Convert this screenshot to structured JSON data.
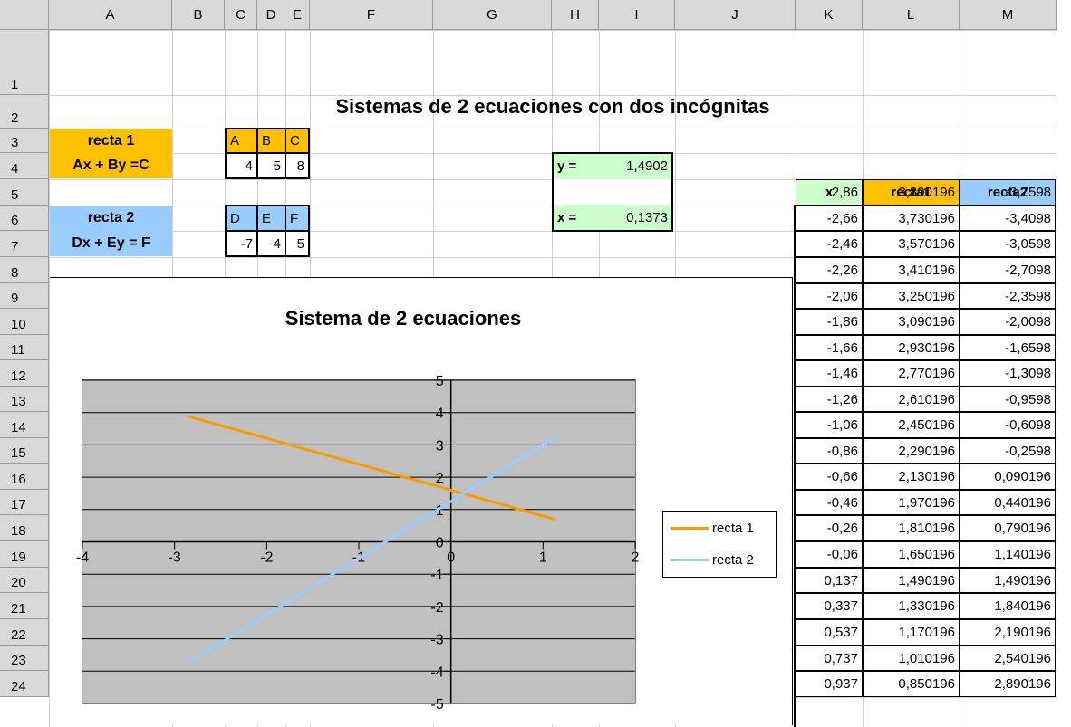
{
  "title": "Sistemas de 2 ecuaciones con dos incógnitas",
  "columns": [
    "A",
    "B",
    "C",
    "D",
    "E",
    "F",
    "G",
    "H",
    "I",
    "J",
    "K",
    "L",
    "M"
  ],
  "rows": [
    "1",
    "2",
    "3",
    "4",
    "5",
    "6",
    "7",
    "8",
    "9",
    "10",
    "11",
    "12",
    "13",
    "14",
    "15",
    "16",
    "17",
    "18",
    "19",
    "20",
    "21",
    "22",
    "23",
    "24"
  ],
  "recta1": {
    "label": "recta 1",
    "formula": "Ax + By =C",
    "headers": [
      "A",
      "B",
      "C"
    ],
    "values": [
      "4",
      "5",
      "8"
    ]
  },
  "recta2": {
    "label": "recta 2",
    "formula": "Dx + Ey = F",
    "headers": [
      "D",
      "E",
      "F"
    ],
    "values": [
      "-7",
      "4",
      "5"
    ]
  },
  "solution": {
    "y_label": "y =",
    "y_value": "1,4902",
    "x_label": "x =",
    "x_value": "0,1373"
  },
  "table": {
    "headers": [
      "x",
      "recta1",
      "recta2"
    ],
    "rows": [
      [
        "-2,86",
        "3,890196",
        "-3,7598"
      ],
      [
        "-2,66",
        "3,730196",
        "-3,4098"
      ],
      [
        "-2,46",
        "3,570196",
        "-3,0598"
      ],
      [
        "-2,26",
        "3,410196",
        "-2,7098"
      ],
      [
        "-2,06",
        "3,250196",
        "-2,3598"
      ],
      [
        "-1,86",
        "3,090196",
        "-2,0098"
      ],
      [
        "-1,66",
        "2,930196",
        "-1,6598"
      ],
      [
        "-1,46",
        "2,770196",
        "-1,3098"
      ],
      [
        "-1,26",
        "2,610196",
        "-0,9598"
      ],
      [
        "-1,06",
        "2,450196",
        "-0,6098"
      ],
      [
        "-0,86",
        "2,290196",
        "-0,2598"
      ],
      [
        "-0,66",
        "2,130196",
        "0,090196"
      ],
      [
        "-0,46",
        "1,970196",
        "0,440196"
      ],
      [
        "-0,26",
        "1,810196",
        "0,790196"
      ],
      [
        "-0,06",
        "1,650196",
        "1,140196"
      ],
      [
        "0,137",
        "1,490196",
        "1,490196"
      ],
      [
        "0,337",
        "1,330196",
        "1,840196"
      ],
      [
        "0,537",
        "1,170196",
        "2,190196"
      ],
      [
        "0,737",
        "1,010196",
        "2,540196"
      ],
      [
        "0,937",
        "0,850196",
        "2,890196"
      ]
    ]
  },
  "colors": {
    "orange": "#ffc000",
    "blue": "#99ccff",
    "green": "#ccffcc",
    "series1": "#ff9900",
    "series2": "#99ccff",
    "plot_bg": "#c0c0c0"
  },
  "chart_data": {
    "type": "line",
    "title": "Sistema de 2 ecuaciones",
    "xlim": [
      -4,
      2
    ],
    "ylim": [
      -5,
      5
    ],
    "x_ticks": [
      "-4",
      "-3",
      "-2",
      "-1",
      "0",
      "1",
      "2"
    ],
    "y_ticks": [
      "5",
      "4",
      "3",
      "2",
      "1",
      "0",
      "-1",
      "-2",
      "-3",
      "-4",
      "-5"
    ],
    "grid": true,
    "legend_position": "right",
    "series": [
      {
        "name": "recta 1",
        "color": "#ff9900",
        "x": [
          -2.86,
          -2.66,
          -2.46,
          -2.26,
          -2.06,
          -1.86,
          -1.66,
          -1.46,
          -1.26,
          -1.06,
          -0.86,
          -0.66,
          -0.46,
          -0.26,
          -0.06,
          0.137,
          0.337,
          0.537,
          0.737,
          0.937,
          1.137
        ],
        "y": [
          3.890196,
          3.730196,
          3.570196,
          3.410196,
          3.250196,
          3.090196,
          2.930196,
          2.770196,
          2.610196,
          2.450196,
          2.290196,
          2.130196,
          1.970196,
          1.810196,
          1.650196,
          1.490196,
          1.330196,
          1.170196,
          1.010196,
          0.850196,
          0.690196
        ]
      },
      {
        "name": "recta 2",
        "color": "#99ccff",
        "x": [
          -2.86,
          -2.66,
          -2.46,
          -2.26,
          -2.06,
          -1.86,
          -1.66,
          -1.46,
          -1.26,
          -1.06,
          -0.86,
          -0.66,
          -0.46,
          -0.26,
          -0.06,
          0.137,
          0.337,
          0.537,
          0.737,
          0.937,
          1.137
        ],
        "y": [
          -3.7598,
          -3.4098,
          -3.0598,
          -2.7098,
          -2.3598,
          -2.0098,
          -1.6598,
          -1.3098,
          -0.9598,
          -0.6098,
          -0.2598,
          0.090196,
          0.440196,
          0.790196,
          1.140196,
          1.490196,
          1.840196,
          2.190196,
          2.540196,
          2.890196,
          3.240196
        ]
      }
    ]
  }
}
